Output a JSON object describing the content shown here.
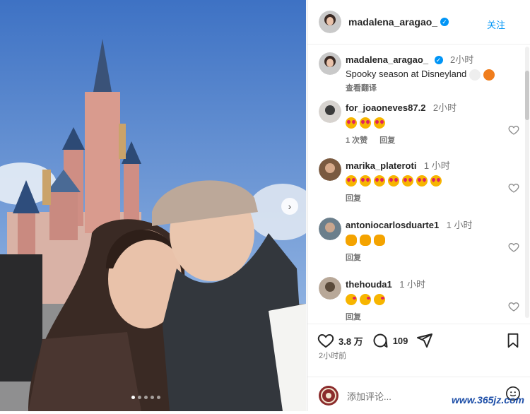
{
  "post": {
    "author": "madalena_aragao_",
    "follow_label": "关注",
    "caption": "Spooky season at Disneyland",
    "caption_time": "2小时",
    "see_translation": "查看翻译",
    "likes": "3.8 万",
    "comment_count": "109",
    "posted_ago": "2小时前",
    "add_comment_placeholder": "添加评论...",
    "image_dots_total": 5,
    "image_dots_active": 0
  },
  "comments": [
    {
      "user": "for_joaoneves87.2",
      "time": "2小时",
      "emoji": "eyes",
      "emoji_count": 3,
      "likes": "1 次赞",
      "reply": "回复"
    },
    {
      "user": "marika_plateroti",
      "time": "1 小时",
      "emoji": "eyes",
      "emoji_count": 7,
      "reply": "回复"
    },
    {
      "user": "antoniocarlosduarte1",
      "time": "1 小时",
      "emoji": "hands",
      "emoji_count": 3,
      "reply": "回复"
    },
    {
      "user": "thehouda1",
      "time": "1 小时",
      "emoji": "kiss",
      "emoji_count": 3,
      "reply": "回复"
    }
  ],
  "watermark": "www.365jz.com",
  "colors": {
    "accent": "#0095f6",
    "text": "#262626",
    "muted": "#737373"
  }
}
